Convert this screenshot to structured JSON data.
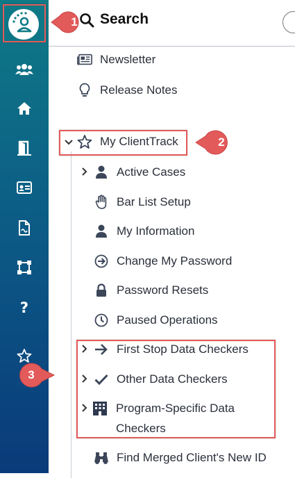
{
  "header": {
    "title": "Search"
  },
  "menu": {
    "newsletter": "Newsletter",
    "release_notes": "Release Notes",
    "my_clienttrack": "My ClientTrack",
    "active_cases": "Active Cases",
    "bar_list_setup": "Bar List Setup",
    "my_information": "My Information",
    "change_password": "Change My Password",
    "password_resets": "Password Resets",
    "paused_operations": "Paused Operations",
    "first_stop": "First Stop Data Checkers",
    "other_checkers": "Other Data Checkers",
    "program_specific_line1": "Program-Specific Data",
    "program_specific_line2": "Checkers",
    "find_merged": "Find Merged Client's New ID"
  },
  "annotations": {
    "badge1": "1",
    "badge2": "2",
    "badge3": "3"
  },
  "rail_icons": [
    "logo-icon",
    "people-icon",
    "home-icon",
    "door-icon",
    "id-card-icon",
    "document-icon",
    "workflow-icon",
    "help-icon",
    "star-icon"
  ],
  "colors": {
    "accent_red": "#e35a5a",
    "rail_top": "#0f7a86",
    "rail_bottom": "#0a3a7a",
    "icon_dark": "#2f3a4f"
  }
}
